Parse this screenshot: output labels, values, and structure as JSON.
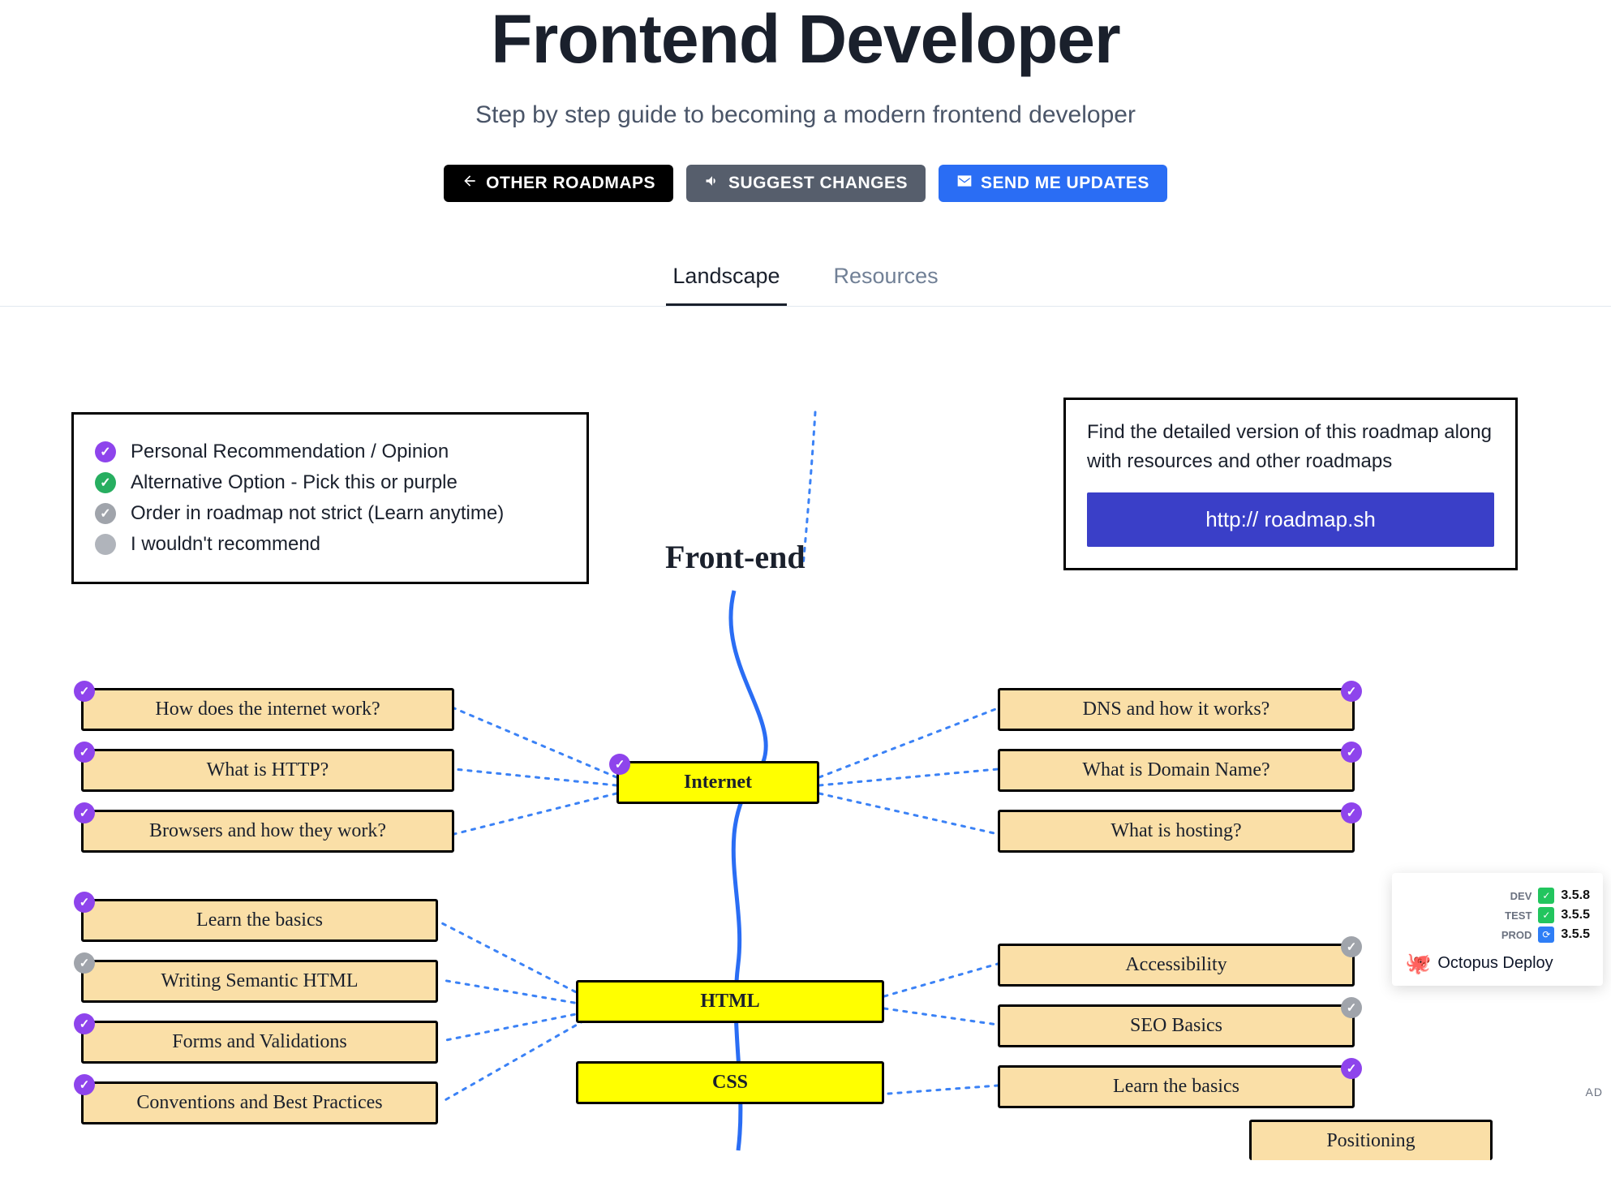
{
  "header": {
    "title": "Frontend Developer",
    "subtitle": "Step by step guide to becoming a modern frontend developer",
    "buttons": {
      "other": "OTHER ROADMAPS",
      "suggest": "SUGGEST CHANGES",
      "updates": "SEND ME UPDATES"
    }
  },
  "tabs": {
    "landscape": "Landscape",
    "resources": "Resources"
  },
  "legend": {
    "purple": "Personal Recommendation / Opinion",
    "green": "Alternative Option - Pick this or purple",
    "gray": "Order in roadmap not strict (Learn anytime)",
    "solid": "I wouldn't recommend"
  },
  "promo": {
    "text": "Find the detailed version of this roadmap along with resources and other roadmaps",
    "link": "http:// roadmap.sh"
  },
  "diagram": {
    "title": "Front-end",
    "internet": {
      "label": "Internet",
      "left": [
        "How does the internet work?",
        "What is HTTP?",
        "Browsers and how they work?"
      ],
      "right": [
        "DNS and how it works?",
        "What is Domain Name?",
        "What is hosting?"
      ]
    },
    "html": {
      "label": "HTML",
      "left": [
        "Learn the basics",
        "Writing Semantic HTML",
        "Forms and Validations",
        "Conventions and Best Practices"
      ],
      "right": [
        "Accessibility",
        "SEO Basics",
        "Learn the basics"
      ]
    },
    "css": {
      "label": "CSS",
      "right_extra": "Positioning"
    }
  },
  "ad": {
    "envs": [
      {
        "label": "DEV",
        "version": "3.5.8",
        "color": "green"
      },
      {
        "label": "TEST",
        "version": "3.5.5",
        "color": "green"
      },
      {
        "label": "PROD",
        "version": "3.5.5",
        "color": "blue"
      }
    ],
    "brand": "Octopus Deploy",
    "tag": "AD"
  }
}
